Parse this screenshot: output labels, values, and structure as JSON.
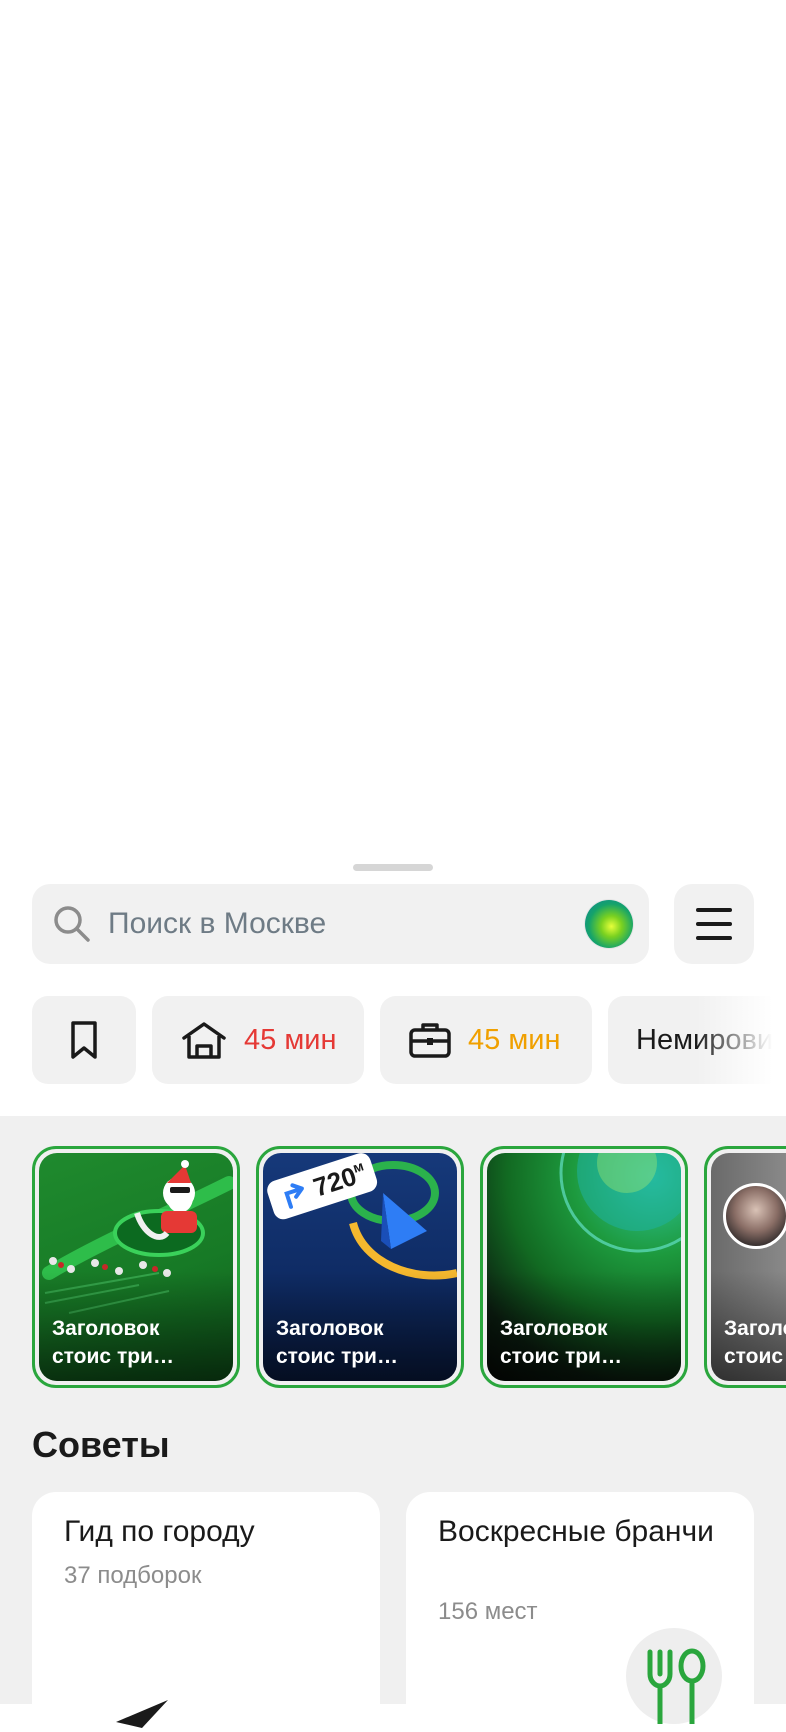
{
  "search": {
    "placeholder": "Поиск в Москве"
  },
  "quick_chips": {
    "home": {
      "label": "45 мин",
      "color": "#e53935"
    },
    "work": {
      "label": "45 мин",
      "color": "#f0a000"
    },
    "place": {
      "label": "Немирович"
    }
  },
  "stories": [
    {
      "title": "Заголовок\nстоис три…"
    },
    {
      "title": "Заголовок\nстоис три…",
      "badge": "720",
      "badge_unit": "м"
    },
    {
      "title": "Заголовок\nстоис три…"
    },
    {
      "title": "Заголо\nстоис"
    }
  ],
  "tips": {
    "title": "Советы",
    "cards": [
      {
        "title": "Гид по городу",
        "subtitle": "37 подборок"
      },
      {
        "title": "Воскресные бранчи",
        "subtitle": "156 мест"
      }
    ]
  },
  "colors": {
    "accent_green": "#2aa63d",
    "chip_bg": "#f1f1f1"
  }
}
